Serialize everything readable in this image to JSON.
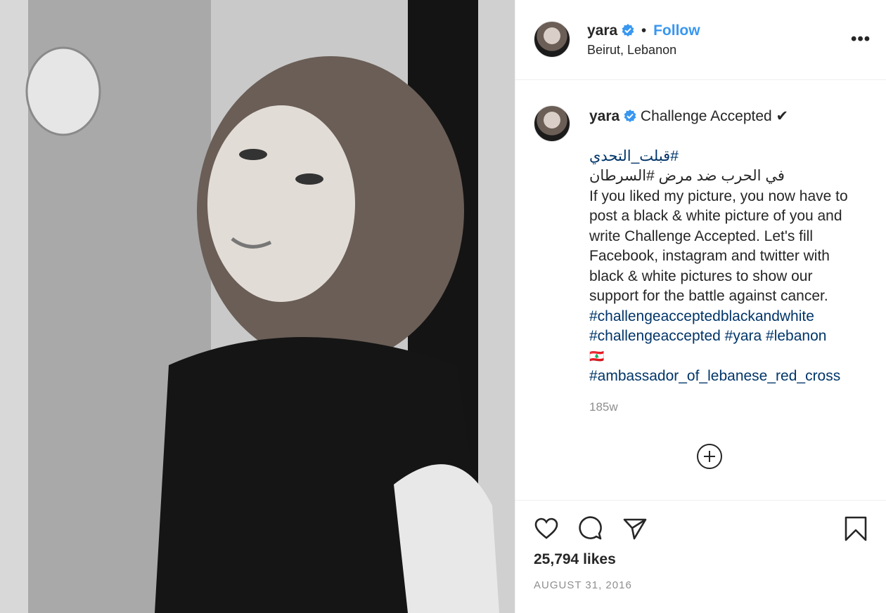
{
  "post": {
    "author": "yara",
    "follow_label": "Follow",
    "dot": "•",
    "location": "Beirut, Lebanon",
    "more_label": "•••"
  },
  "caption": {
    "author": "yara",
    "title": "Challenge Accepted ✔",
    "lines": [
      "#قبلت_التحدي",
      "في الحرب ضد مرض #السرطان",
      "If you liked my picture, you now have to",
      "post a black & white picture of you and",
      "write Challenge Accepted. Let's fill",
      "Facebook, instagram and twitter with",
      "black & white pictures to show our",
      "support for the battle against cancer.",
      "#challengeacceptedblackandwhite",
      "#challengeaccepted #yara #lebanon",
      "🇱🇧",
      "#ambassador_of_lebanese_red_cross"
    ],
    "time_ago": "185w"
  },
  "stats": {
    "likes": "25,794 likes",
    "date": "AUGUST 31, 2016"
  },
  "icons": {
    "verified": "verified-badge-icon",
    "like": "heart-icon",
    "comment": "comment-icon",
    "share": "share-icon",
    "save": "bookmark-icon",
    "load_more": "plus-circle-icon"
  },
  "colors": {
    "link": "#3897f0",
    "hashtag": "#003569",
    "muted": "#8e8e8e",
    "text": "#262626"
  }
}
